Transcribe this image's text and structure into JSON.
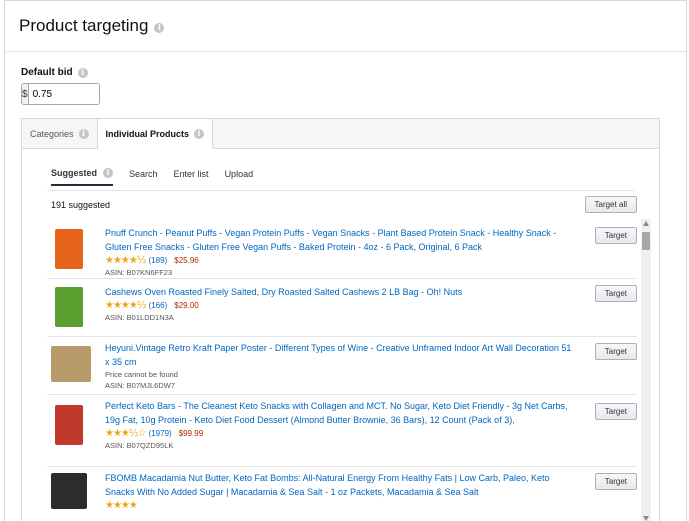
{
  "header": {
    "title": "Product targeting"
  },
  "bid": {
    "label": "Default bid",
    "currency": "$",
    "value": "0.75"
  },
  "tabs": [
    {
      "label": "Categories",
      "active": false
    },
    {
      "label": "Individual Products",
      "active": true
    }
  ],
  "subtabs": [
    {
      "label": "Suggested",
      "active": true
    },
    {
      "label": "Search",
      "active": false
    },
    {
      "label": "Enter list",
      "active": false
    },
    {
      "label": "Upload",
      "active": false
    }
  ],
  "list": {
    "count": "191 suggested",
    "target_all_label": "Target all",
    "target_label": "Target",
    "items": [
      {
        "title": "Pnuff Crunch - Peanut Puffs - Vegan Protein Puffs - Vegan Snacks - Plant Based Protein Snack - Healthy Snack - Gluten Free Snacks - Gluten Free Vegan Puffs - Baked Protein - 4oz - 6 Pack, Original, 6 Pack",
        "stars": "★★★★½",
        "reviews": "(189)",
        "price": "$25.96",
        "note": "",
        "asin": "ASIN: B07KN6FF23",
        "thumb_color": "#e8641b"
      },
      {
        "title": "Cashews Oven Roasted Finely Salted, Dry Roasted Salted Cashews 2 LB Bag - Oh! Nuts",
        "stars": "★★★★½",
        "reviews": "(166)",
        "price": "$29.00",
        "note": "",
        "asin": "ASIN: B01LDD1N3A",
        "thumb_color": "#5a9e2f"
      },
      {
        "title": "Heyuni.Vintage Retro Kraft Paper Poster - Different Types of Wine - Creative Unframed Indoor Art Wall Decoration 51 x 35 cm",
        "stars": "",
        "reviews": "",
        "price": "",
        "note": "Price cannot be found",
        "asin": "ASIN: B07MJL6DW7",
        "thumb_color": "#b79a6a"
      },
      {
        "title": "Perfect Keto Bars - The Cleanest Keto Snacks with Collagen and MCT. No Sugar, Keto Diet Friendly - 3g Net Carbs, 19g Fat, 10g Protein - Keto Diet Food Dessert (Almond Butter Brownie, 36 Bars), 12 Count (Pack of 3),",
        "stars": "★★★½☆",
        "reviews": "(1979)",
        "price": "$99.99",
        "note": "",
        "asin": "ASIN: B07QZD95LK",
        "thumb_color": "#c0392b"
      },
      {
        "title": "FBOMB Macadamia Nut Butter, Keto Fat Bombs: All-Natural Energy From Healthy Fats | Low Carb, Paleo, Keto Snacks With No Added Sugar | Macadamia & Sea Salt - 1 oz Packets, Macadamia & Sea Salt",
        "stars": "★★★★",
        "reviews": "",
        "price": "",
        "note": "",
        "asin": "",
        "thumb_color": "#2c2c2c"
      }
    ]
  }
}
